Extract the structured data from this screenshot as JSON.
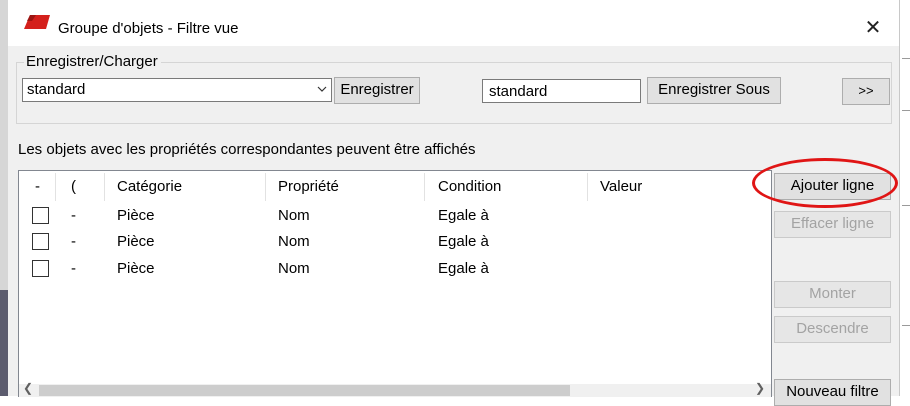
{
  "window": {
    "title": "Groupe d'objets - Filtre vue",
    "icon": "app-red-icon",
    "close_label": "✕"
  },
  "save_load": {
    "group_label": "Enregistrer/Charger",
    "selected_preset": "standard",
    "save_label": "Enregistrer",
    "save_as_value": "standard",
    "save_as_label": "Enregistrer Sous",
    "more_label": ">>"
  },
  "description": "Les objets avec les propriétés correspondantes peuvent être affichés",
  "table": {
    "columns": [
      "-",
      "(",
      "Catégorie",
      "Propriété",
      "Condition",
      "Valeur"
    ],
    "rows": [
      {
        "checked": false,
        "op": "-",
        "paren": "",
        "category": "Pièce",
        "property": "Nom",
        "condition": "Egale à",
        "value": ""
      },
      {
        "checked": false,
        "op": "-",
        "paren": "",
        "category": "Pièce",
        "property": "Nom",
        "condition": "Egale à",
        "value": ""
      },
      {
        "checked": false,
        "op": "-",
        "paren": "",
        "category": "Pièce",
        "property": "Nom",
        "condition": "Egale à",
        "value": ""
      }
    ]
  },
  "side_buttons": {
    "add_row": "Ajouter ligne",
    "delete_row": "Effacer ligne",
    "move_up": "Monter",
    "move_down": "Descendre",
    "new_filter": "Nouveau filtre"
  },
  "colors": {
    "highlight_circle": "#e01515",
    "dialog_bg": "#f0f0f0"
  }
}
